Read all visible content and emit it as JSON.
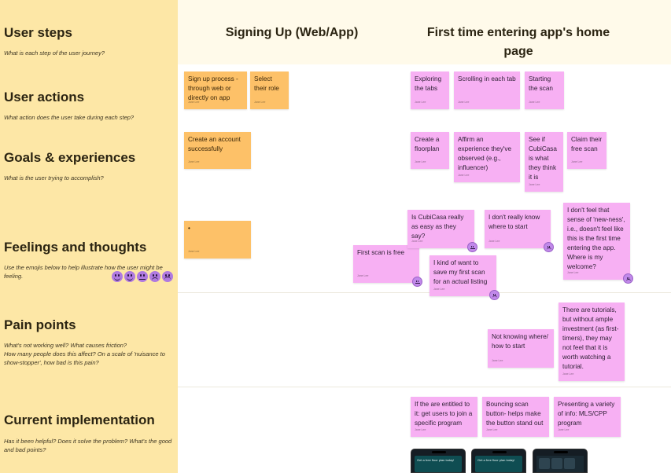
{
  "rows": [
    {
      "title": "User steps",
      "subtitle": "What is each step of the user journey?"
    },
    {
      "title": "User actions",
      "subtitle": "What action does the user take during each step?"
    },
    {
      "title": "Goals & experiences",
      "subtitle": "What is the user trying to accomplish?"
    },
    {
      "title": "Feelings and thoughts",
      "subtitle": "Use the emojis below to help illustrate how the user might be feeling."
    },
    {
      "title": "Pain points",
      "subtitle": "What's not working well? What causes friction?\nHow many people does this affect? On a scale of 'nuisance to show-stopper', how bad is this pain?"
    },
    {
      "title": "Current implementation",
      "subtitle": "Has it been helpful? Does it solve the problem? What's the good and bad points?"
    }
  ],
  "emoji_scale": [
    "very-happy-icon",
    "happy-icon",
    "neutral-icon",
    "sad-icon",
    "very-sad-icon"
  ],
  "columns": {
    "signup": "Signing Up (Web/App)",
    "first_time": "First time entering app's home page"
  },
  "notes": {
    "a1": "Sign up process - through web or directly on app",
    "a2": "Select their role",
    "a3": "Exploring the tabs",
    "a4": "Scrolling in each tab",
    "a5": "Starting the scan",
    "g1": "Create an account successfully",
    "g2": "Create a floorplan",
    "g3": "Affirm an experience they've observed (e.g., influencer)",
    "g4": "See if CubiCasa is what they think it is",
    "g5": "Claim their free scan",
    "f1": "•",
    "f2": "First scan is free",
    "f3": "Is CubiCasa really as easy as they say?",
    "f4": "I kind of want to save my first scan for an actual listing",
    "f5": "I don't really know where to start",
    "f6": "I don't feel that sense of 'new-ness', i.e., doesn't feel like this is the first time entering the app. Where is my welcome?",
    "p1": "Not knowing where/ how to start",
    "p2": "There are tutorials, but without ample investment (as first-timers), they may not feel that it is worth watching a tutorial.",
    "c1": "If the are entitled to it: get users to join a specific program",
    "c2": "Bouncing scan button- helps make the button stand out",
    "c3": "Presenting a variety of info: MLS/CPP program"
  },
  "note_author": "Jane Lee",
  "phones": {
    "p1_text": "Get a free floor plan today!",
    "p2_text": "Get a free floor plan today!"
  },
  "colors": {
    "row_label_bg": "#fde7a6",
    "header_bg": "#fffaea",
    "orange_note": "#fdc168",
    "pink_note": "#f7b0f3",
    "emoji": "#b07ae0"
  }
}
